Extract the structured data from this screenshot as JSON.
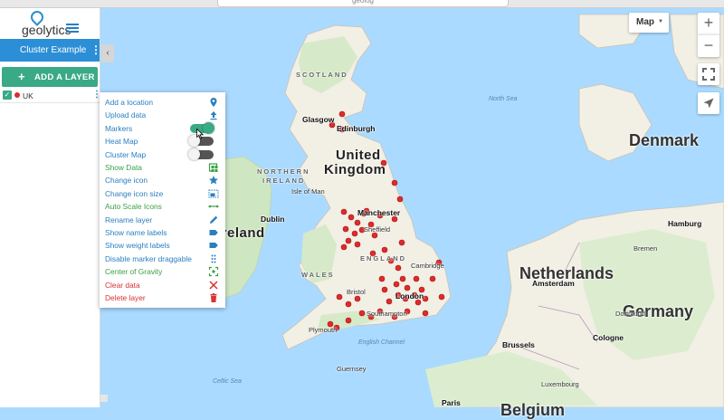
{
  "browser": {
    "url": "geolog"
  },
  "app": {
    "logo_text": "geolytics"
  },
  "sidebar": {
    "project_name": "Cluster Example",
    "add_layer_label": "ADD A LAYER",
    "add_layer_icon": "+",
    "layers": [
      {
        "name": "UK",
        "color": "#e02a2a",
        "checked": true
      }
    ]
  },
  "context_menu": {
    "items": [
      {
        "label": "Add a location",
        "color": "blue",
        "icon": "map-pin-icon"
      },
      {
        "label": "Upload data",
        "color": "blue",
        "icon": "upload-icon"
      },
      {
        "label": "Markers",
        "color": "blue",
        "toggle": true
      },
      {
        "label": "Heat Map",
        "color": "blue",
        "toggle": false
      },
      {
        "label": "Cluster Map",
        "color": "blue",
        "toggle": false
      },
      {
        "label": "Show Data",
        "color": "green",
        "icon": "table-icon"
      },
      {
        "label": "Change icon",
        "color": "blue",
        "icon": "star-icon"
      },
      {
        "label": "Change icon size",
        "color": "blue",
        "icon": "resize-icon"
      },
      {
        "label": "Auto Scale Icons",
        "color": "green",
        "icon": "scale-arrows-icon"
      },
      {
        "label": "Rename layer",
        "color": "blue",
        "icon": "pencil-icon"
      },
      {
        "label": "Show name labels",
        "color": "blue",
        "icon": "label-tag-icon"
      },
      {
        "label": "Show weight labels",
        "color": "blue",
        "icon": "label-tag-icon"
      },
      {
        "label": "Disable marker draggable",
        "color": "blue",
        "icon": "drag-dots-icon"
      },
      {
        "label": "Center of Gravity",
        "color": "green",
        "icon": "target-icon"
      },
      {
        "label": "Clear data",
        "color": "red",
        "icon": "close-x-icon"
      },
      {
        "label": "Delete layer",
        "color": "red",
        "icon": "trash-icon"
      }
    ]
  },
  "map_controls": {
    "map_type": "Map",
    "zoom_in": "+",
    "zoom_out": "−"
  },
  "map": {
    "labels": {
      "scotland": "SCOTLAND",
      "united_kingdom_1": "United",
      "united_kingdom_2": "Kingdom",
      "north_sea": "North Sea",
      "northern_ireland_1": "NORTHERN",
      "northern_ireland_2": "IRELAND",
      "isle_of_man": "Isle of Man",
      "dublin": "Dublin",
      "ireland": "Ireland",
      "wales": "WALES",
      "england": "ENGLAND",
      "glasgow": "Glasgow",
      "edinburgh": "Edinburgh",
      "manchester": "Manchester",
      "sheffield": "Sheffield",
      "cambridge": "Cambridge",
      "bristol": "Bristol",
      "london": "London",
      "southampton": "Southampton",
      "plymouth": "Plymouth",
      "english_channel": "English Channel",
      "guernsey": "Guernsey",
      "celtic_sea": "Celtic Sea",
      "denmark": "Denmark",
      "netherlands": "Netherlands",
      "belgium": "Belgium",
      "germany": "Germany",
      "amsterdam": "Amsterdam",
      "hamburg": "Hamburg",
      "brussels": "Brussels",
      "cologne": "Cologne",
      "dortmund": "Dortmund",
      "bremen": "Bremen",
      "luxembourg": "Luxembourg",
      "paris": "Paris"
    }
  },
  "colors": {
    "accent_blue": "#2b8ed6",
    "accent_green": "#3aa985",
    "menu_blue": "#2a7fc0",
    "menu_green": "#3aa043",
    "menu_red": "#d83232",
    "marker_red": "#e02a2a",
    "water": "#aadaff",
    "land": "#f2efe5",
    "green_land": "#cfe6c2"
  }
}
